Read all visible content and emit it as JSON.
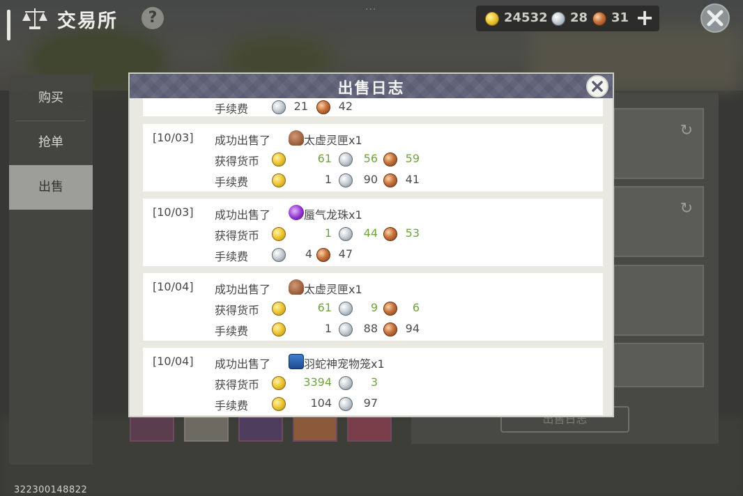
{
  "header": {
    "title": "交易所",
    "help": "?",
    "drag_handle": "···",
    "wallet": {
      "gold": "24532",
      "silver": "28",
      "copper": "31"
    },
    "add_label": "+"
  },
  "sidenav": {
    "items": [
      {
        "label": "购买"
      },
      {
        "label": "抢单"
      },
      {
        "label": "出售"
      }
    ],
    "active": "出售"
  },
  "right_panel": {
    "sale_log_button": "出售日志"
  },
  "uid": "322300148822",
  "modal": {
    "title": "出售日志",
    "partial_top": {
      "fee_label": "手续费",
      "silver": "21",
      "copper": "42"
    },
    "entries": [
      {
        "date": "[10/03]",
        "action": "成功出售了",
        "item_name": "太虚灵匣x1",
        "item_icon": "box-icon",
        "earned_label": "获得货币",
        "earned": {
          "gold": "61",
          "silver": "56",
          "copper": "59"
        },
        "fee_label": "手续费",
        "fee": {
          "gold": "1",
          "silver": "90",
          "copper": "41"
        }
      },
      {
        "date": "[10/03]",
        "action": "成功出售了",
        "item_name": "蜃气龙珠x1",
        "item_icon": "orb-icon",
        "earned_label": "获得货币",
        "earned": {
          "gold": "1",
          "silver": "44",
          "copper": "53"
        },
        "fee_label": "手续费",
        "fee": {
          "silver": "4",
          "copper": "47"
        }
      },
      {
        "date": "[10/04]",
        "action": "成功出售了",
        "item_name": "太虚灵匣x1",
        "item_icon": "box-icon",
        "earned_label": "获得货币",
        "earned": {
          "gold": "61",
          "silver": "9",
          "copper": "6"
        },
        "fee_label": "手续费",
        "fee": {
          "gold": "1",
          "silver": "88",
          "copper": "94"
        }
      },
      {
        "date": "[10/04]",
        "action": "成功出售了",
        "item_name": "羽蛇神宠物笼x1",
        "item_icon": "cage-icon",
        "earned_label": "获得货币",
        "earned": {
          "gold": "3394",
          "silver": "3"
        },
        "fee_label": "手续费",
        "fee": {
          "gold": "104",
          "silver": "97"
        }
      }
    ]
  },
  "colors": {
    "earned_value": "#6fa43d",
    "modal_header": "#5a5d73",
    "active_tab": "#9d9e99"
  }
}
